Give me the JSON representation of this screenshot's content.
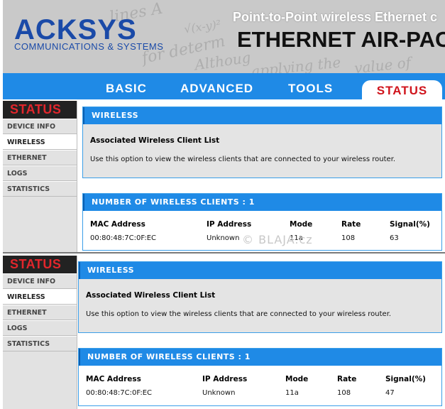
{
  "header": {
    "brand": "ACKSYS",
    "brand_sub": "COMMUNICATIONS & SYSTEMS",
    "tagline": "Point-to-Point wireless Ethernet c",
    "product": "ETHERNET AIR-PAC"
  },
  "nav": {
    "basic": "BASIC",
    "advanced": "ADVANCED",
    "tools": "TOOLS",
    "status": "STATUS"
  },
  "sidebar": {
    "title": "STATUS",
    "items": [
      "DEVICE INFO",
      "WIRELESS",
      "ETHERNET",
      "LOGS",
      "STATISTICS"
    ]
  },
  "panels": [
    {
      "wireless_title": "WIRELESS",
      "subtitle": "Associated Wireless Client List",
      "description": "Use this option to view the wireless clients that are connected to your wireless router.",
      "clients_title": "NUMBER OF WIRELESS CLIENTS : 1",
      "columns": [
        "MAC Address",
        "IP Address",
        "Mode",
        "Rate",
        "Signal(%)"
      ],
      "row": [
        "00:80:48:7C:0F:EC",
        "Unknown",
        "11a",
        "108",
        "63"
      ]
    },
    {
      "wireless_title": "WIRELESS",
      "subtitle": "Associated Wireless Client List",
      "description": "Use this option to view the wireless clients that are connected to your wireless router.",
      "clients_title": "NUMBER OF WIRELESS CLIENTS : 1",
      "columns": [
        "MAC Address",
        "IP Address",
        "Mode",
        "Rate",
        "Signal(%)"
      ],
      "row": [
        "00:80:48:7C:0F:EC",
        "Unknown",
        "11a",
        "108",
        "47"
      ]
    }
  ],
  "watermark": "© BLAJA.cz"
}
